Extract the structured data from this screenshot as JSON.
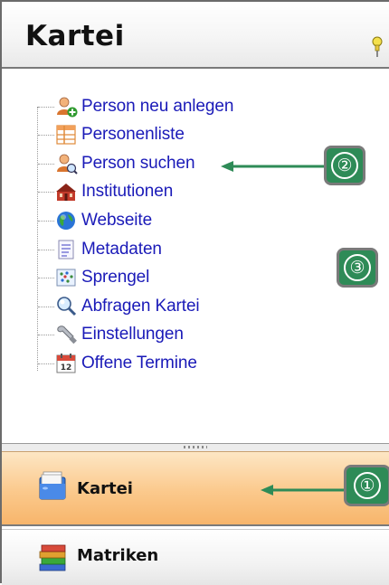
{
  "header": {
    "title": "Kartei",
    "pin_icon": "pin-icon"
  },
  "tree": {
    "items": [
      {
        "label": "Person neu anlegen",
        "icon": "person-add-icon"
      },
      {
        "label": "Personenliste",
        "icon": "list-icon"
      },
      {
        "label": "Person suchen",
        "icon": "person-search-icon"
      },
      {
        "label": "Institutionen",
        "icon": "institution-icon"
      },
      {
        "label": "Webseite",
        "icon": "globe-icon"
      },
      {
        "label": "Metadaten",
        "icon": "metadata-icon"
      },
      {
        "label": "Sprengel",
        "icon": "map-icon"
      },
      {
        "label": "Abfragen Kartei",
        "icon": "magnifier-icon"
      },
      {
        "label": "Einstellungen",
        "icon": "wrench-icon"
      },
      {
        "label": "Offene Termine",
        "icon": "calendar-icon"
      }
    ]
  },
  "calendar_day": "12",
  "callouts": {
    "one": "①",
    "two": "②",
    "three": "③"
  },
  "nav": {
    "kartei": {
      "label": "Kartei",
      "icon": "card-box-icon",
      "active": true
    },
    "matriken": {
      "label": "Matriken",
      "icon": "books-icon",
      "active": false
    }
  },
  "colors": {
    "link": "#1a1ab8",
    "callout_bg": "#2e8b57",
    "arrow": "#2e8b57",
    "active_nav": "#fbc98c"
  }
}
